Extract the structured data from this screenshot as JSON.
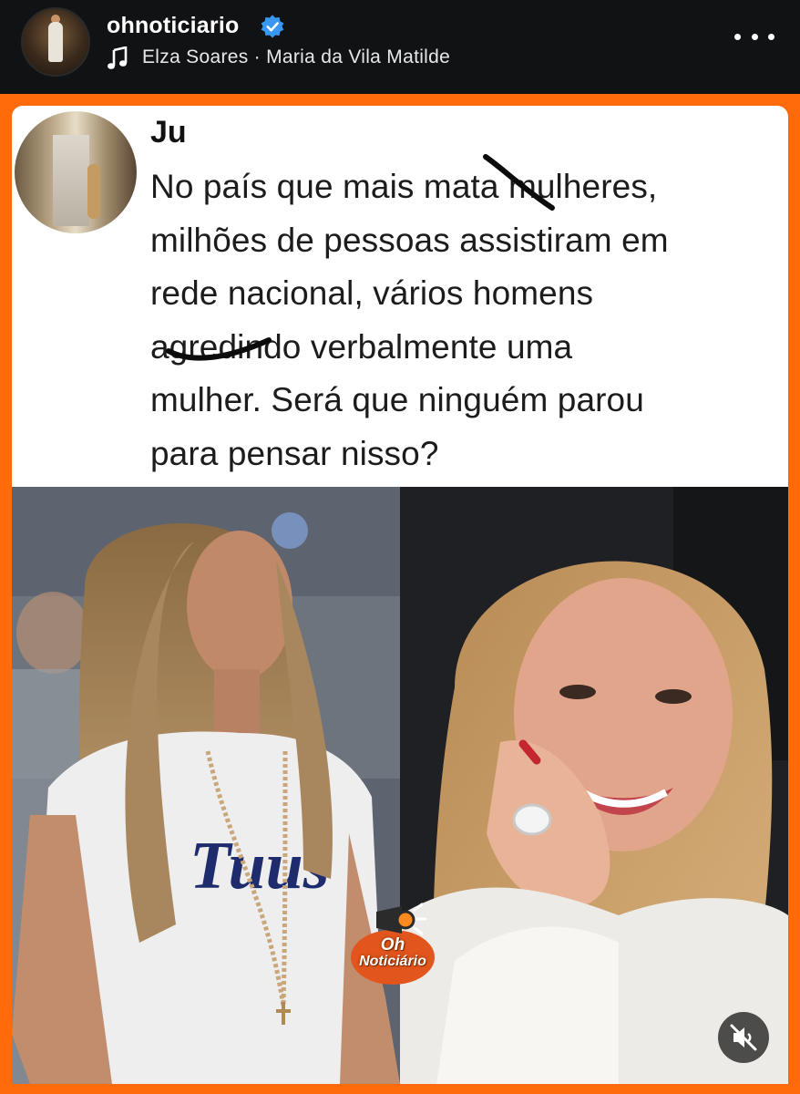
{
  "header": {
    "username": "ohnoticiario",
    "verified": true,
    "audio": "Elza Soares · Maria da Vila Matilde",
    "icons": [
      "verified-badge-icon",
      "music-note-icon",
      "more-options-icon"
    ]
  },
  "tweet": {
    "name": "Ju",
    "lines": [
      "No país que mais mata mulheres,",
      "milhões de pessoas assistiram em",
      "rede nacional, vários homens",
      "agredindo verbalmente uma",
      "mulher. Será que ninguém parou",
      "para pensar nisso?"
    ]
  },
  "watermark": {
    "line1": "Oh",
    "line2": "Noticiário",
    "icon": "megaphone-icon"
  },
  "controls": {
    "mute_icon": "muted-speaker-icon"
  },
  "colors": {
    "frame_orange": "#ff6a0a",
    "header_bg": "#101214",
    "verified_blue": "#3897f0"
  }
}
